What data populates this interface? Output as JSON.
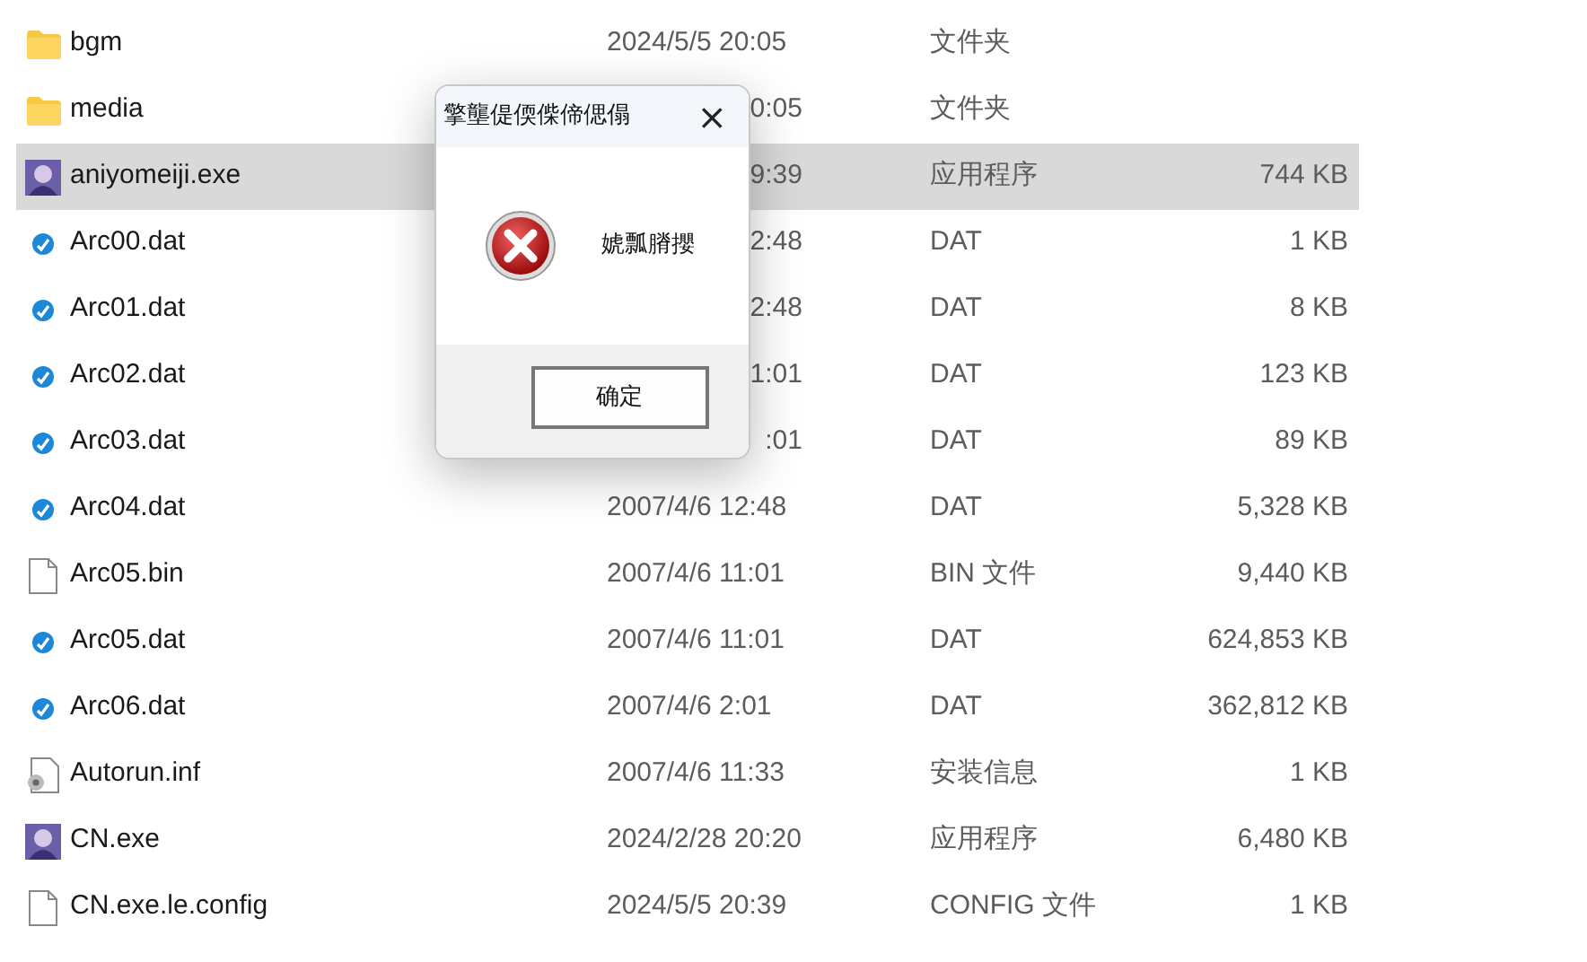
{
  "files": [
    {
      "kind": "folder",
      "name": "bgm",
      "date": "2024/5/5 20:05",
      "date_cut": false,
      "type": "文件夹",
      "selected": false
    },
    {
      "kind": "folder",
      "name": "media",
      "date": "0:05",
      "date_cut": true,
      "type": "文件夹",
      "selected": false
    },
    {
      "kind": "app",
      "name": "aniyomeiji.exe",
      "date": "9:39",
      "date_cut": true,
      "type": "应用程序",
      "size": "744 KB",
      "selected": true
    },
    {
      "kind": "dat",
      "name": "Arc00.dat",
      "date": "2:48",
      "date_cut": true,
      "type": "DAT",
      "size": "1 KB",
      "selected": false
    },
    {
      "kind": "dat",
      "name": "Arc01.dat",
      "date": "2:48",
      "date_cut": true,
      "type": "DAT",
      "size": "8 KB",
      "selected": false
    },
    {
      "kind": "dat",
      "name": "Arc02.dat",
      "date": "1:01",
      "date_cut": true,
      "type": "DAT",
      "size": "123 KB",
      "selected": false
    },
    {
      "kind": "dat",
      "name": "Arc03.dat",
      "date": ":01",
      "date_cut": true,
      "type": "DAT",
      "size": "89 KB",
      "selected": false
    },
    {
      "kind": "dat",
      "name": "Arc04.dat",
      "date": "2007/4/6 12:48",
      "date_cut": false,
      "type": "DAT",
      "size": "5,328 KB",
      "selected": false
    },
    {
      "kind": "blank",
      "name": "Arc05.bin",
      "date": "2007/4/6 11:01",
      "date_cut": false,
      "type": "BIN 文件",
      "size": "9,440 KB",
      "selected": false
    },
    {
      "kind": "dat",
      "name": "Arc05.dat",
      "date": "2007/4/6 11:01",
      "date_cut": false,
      "type": "DAT",
      "size": "624,853 KB",
      "selected": false
    },
    {
      "kind": "dat",
      "name": "Arc06.dat",
      "date": "2007/4/6 2:01",
      "date_cut": false,
      "type": "DAT",
      "size": "362,812 KB",
      "selected": false
    },
    {
      "kind": "settings",
      "name": "Autorun.inf",
      "date": "2007/4/6 11:33",
      "date_cut": false,
      "type": "安装信息",
      "size": "1 KB",
      "selected": false
    },
    {
      "kind": "app",
      "name": "CN.exe",
      "date": "2024/2/28 20:20",
      "date_cut": false,
      "type": "应用程序",
      "size": "6,480 KB",
      "selected": false
    },
    {
      "kind": "blank",
      "name": "CN.exe.le.config",
      "date": "2024/5/5 20:39",
      "date_cut": false,
      "type": "CONFIG 文件",
      "size": "1 KB",
      "selected": false
    }
  ],
  "dialog": {
    "title": "擎壟偍偄偨偙偲傝",
    "close": "×",
    "message": "婋瓢膌攖",
    "button": "确定"
  }
}
